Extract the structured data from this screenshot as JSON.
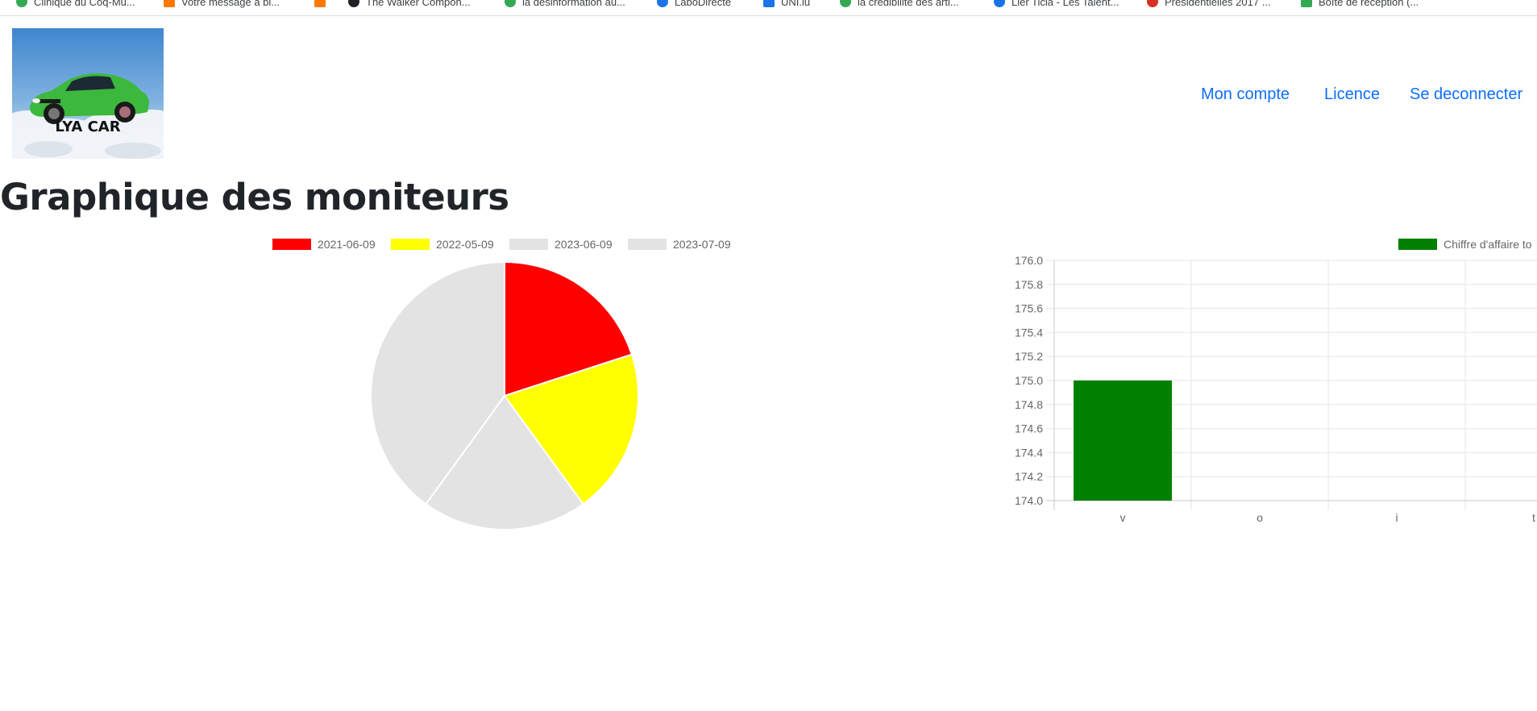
{
  "bookmarks": [
    {
      "label": "Clinique du Coq-Mu...",
      "icon": "green-circle-icon",
      "color": "#34a853"
    },
    {
      "label": "Votre message a bi...",
      "icon": "orange-square-icon",
      "color": "#ff7900"
    },
    {
      "label": "",
      "icon": "orange-logo-icon",
      "color": "#ff7900"
    },
    {
      "label": "The Walker Compon...",
      "icon": "black-circle-icon",
      "color": "#202124"
    },
    {
      "label": "la désinformation au...",
      "icon": "green-circle-icon",
      "color": "#34a853"
    },
    {
      "label": "LaboDirecte",
      "icon": "blue-circle-icon",
      "color": "#1a73e8"
    },
    {
      "label": "UNI.lu",
      "icon": "blue-square-icon",
      "color": "#1a73e8"
    },
    {
      "label": "la crédibilité des arti...",
      "icon": "green-circle-icon",
      "color": "#34a853"
    },
    {
      "label": "Lier Ticia - Les Talent...",
      "icon": "blue-circle-icon",
      "color": "#1a73e8"
    },
    {
      "label": "Présidentielles 2017 ...",
      "icon": "red-pen-icon",
      "color": "#d93025"
    },
    {
      "label": "Boîte de réception (...",
      "icon": "green-square-icon",
      "color": "#34a853"
    }
  ],
  "logo": {
    "text": "LYA CAR",
    "car_color": "#3cb83c",
    "sky_color": "#4a90d9"
  },
  "nav": {
    "account": "Mon compte",
    "license": "Licence",
    "logout": "Se deconnecter"
  },
  "page": {
    "title": "Graphique des moniteurs"
  },
  "chart_data": [
    {
      "type": "pie",
      "categories": [
        "2021-06-09",
        "2022-05-09",
        "2023-06-09",
        "2023-07-09"
      ],
      "values": [
        1,
        1,
        1,
        2
      ],
      "colors": [
        "#ff0000",
        "#ffff00",
        "#e3e3e3",
        "#e3e3e3"
      ],
      "legend_position": "top"
    },
    {
      "type": "bar",
      "categories": [
        "v",
        "o",
        "i",
        "t"
      ],
      "series": [
        {
          "name": "Chiffre d'affaire to",
          "values": [
            175,
            null,
            null,
            null
          ],
          "color": "#008000"
        }
      ],
      "ylim": [
        174,
        176
      ],
      "yticks": [
        "176.0",
        "175.8",
        "175.6",
        "175.4",
        "175.2",
        "175.0",
        "174.8",
        "174.6",
        "174.4",
        "174.2",
        "174.0"
      ],
      "grid": true,
      "legend_position": "top"
    }
  ]
}
